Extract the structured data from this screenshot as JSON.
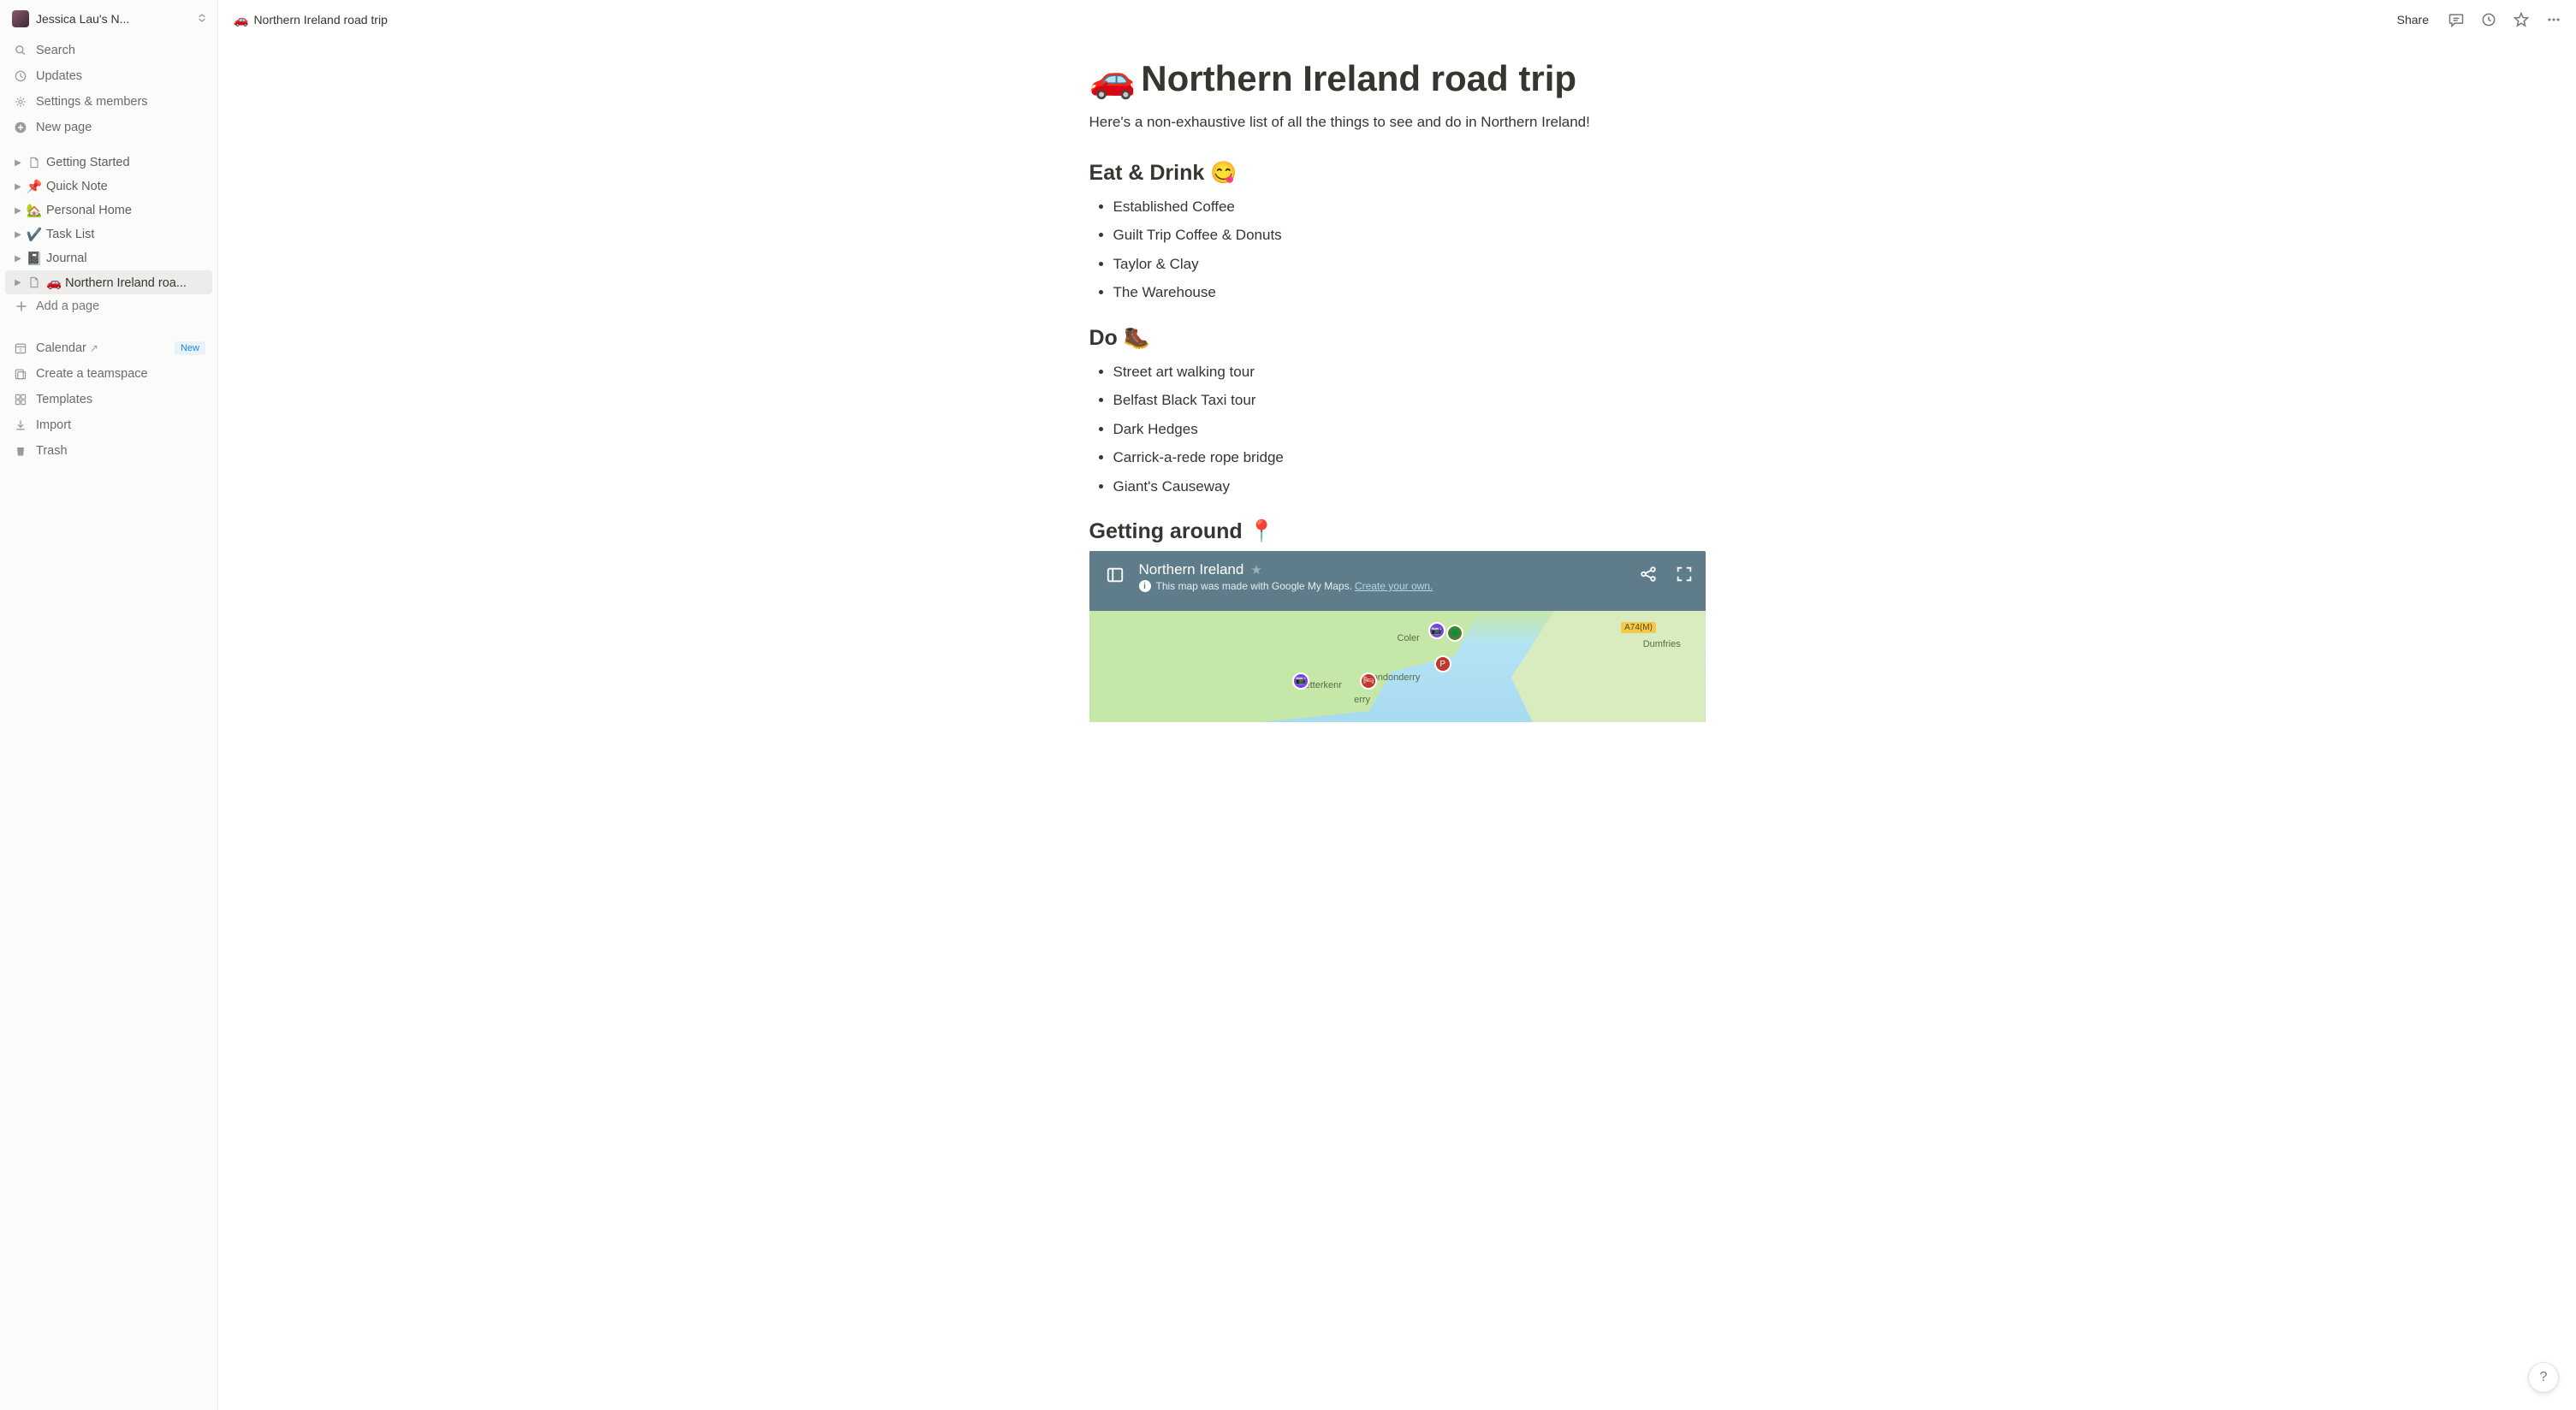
{
  "workspace": {
    "name": "Jessica Lau's N..."
  },
  "nav": {
    "search": "Search",
    "updates": "Updates",
    "settings": "Settings & members",
    "newpage": "New page"
  },
  "pages": [
    {
      "icon": "doc",
      "label": "Getting Started"
    },
    {
      "emoji": "📌",
      "label": "Quick Note"
    },
    {
      "emoji": "🏡",
      "label": "Personal Home"
    },
    {
      "emoji": "✔️",
      "label": "Task List"
    },
    {
      "emoji": "📓",
      "label": "Journal"
    },
    {
      "icon": "doc",
      "emoji": "🚗",
      "label": "Northern Ireland roa...",
      "selected": true
    }
  ],
  "addPage": "Add a page",
  "bottom": {
    "calendar": "Calendar",
    "calendarBadge": "New",
    "teamspace": "Create a teamspace",
    "templates": "Templates",
    "import": "Import",
    "trash": "Trash"
  },
  "topbar": {
    "breadcrumbEmoji": "🚗",
    "breadcrumbTitle": "Northern Ireland road trip",
    "share": "Share"
  },
  "page": {
    "titleEmoji": "🚗",
    "titleText": "Northern Ireland road trip",
    "subtitle": "Here's a non-exhaustive list of all the things to see and do in Northern Ireland!",
    "sections": [
      {
        "heading": "Eat & Drink 😋",
        "items": [
          "Established Coffee",
          "Guilt Trip Coffee & Donuts",
          "Taylor & Clay",
          "The Warehouse"
        ]
      },
      {
        "heading": "Do 🥾",
        "items": [
          "Street art walking tour",
          "Belfast Black Taxi tour",
          "Dark Hedges",
          "Carrick-a-rede rope bridge",
          "Giant's Causeway"
        ]
      }
    ],
    "gettingAround": "Getting around 📍"
  },
  "map": {
    "title": "Northern Ireland",
    "subtitle": "This map was made with Google My Maps.",
    "linkText": "Create your own.",
    "labels": {
      "coler": "Coler",
      "dumfries": "Dumfries",
      "etterkenr": "etterkenr",
      "ondonderry": "ondonderry",
      "erry": "erry",
      "road": "A74(M)"
    }
  },
  "help": "?"
}
